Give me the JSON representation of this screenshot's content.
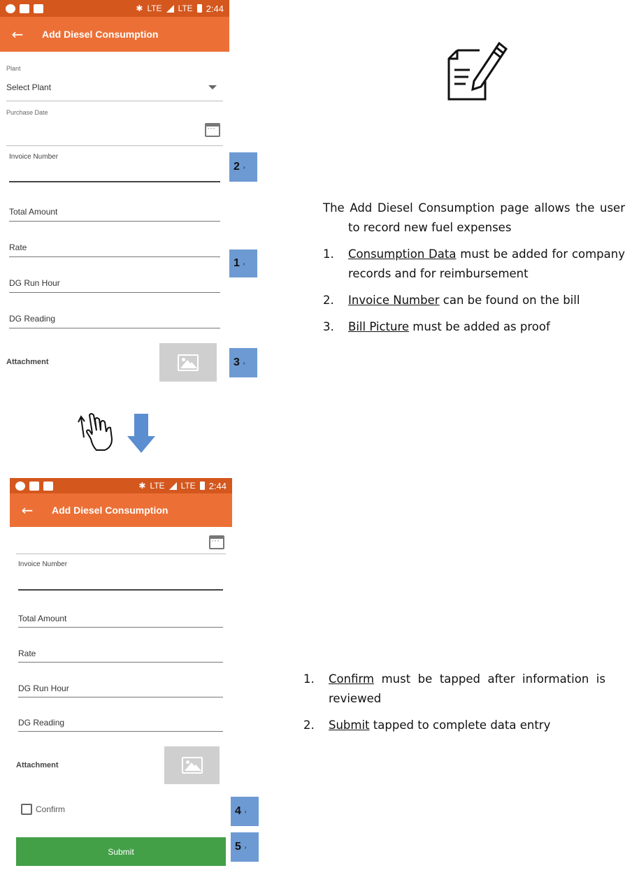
{
  "status_bar": {
    "time": "2:44",
    "network_1": "LTE",
    "network_2": "LTE"
  },
  "app_bar": {
    "back_icon": "arrow-left-icon",
    "title": "Add Diesel Consumption"
  },
  "form": {
    "plant_label": "Plant",
    "plant_value": "Select Plant",
    "purchase_date_label": "Purchase Date",
    "invoice_number_label": "Invoice Number",
    "total_amount_label": "Total Amount",
    "rate_label": "Rate",
    "dg_run_hour_label": "DG Run Hour",
    "dg_reading_label": "DG Reading",
    "attachment_label": "Attachment",
    "confirm_label": "Confirm",
    "submit_label": "Submit"
  },
  "badges": [
    "2",
    "1",
    "3",
    "4",
    "5"
  ],
  "description_1": {
    "intro": "The Add Diesel Consumption page allows the user to record new fuel expenses",
    "items": [
      {
        "num": "1.",
        "link": "Consumption Data",
        "text": " must be added for company records and for reimbursement"
      },
      {
        "num": "2.",
        "link": "Invoice Number",
        "text": " can be found on the bill"
      },
      {
        "num": "3.",
        "link": "Bill Picture",
        "text": " must be added as proof"
      }
    ]
  },
  "description_2": {
    "items": [
      {
        "num": "1.",
        "link": "Confirm",
        "text": " must be tapped after information is reviewed"
      },
      {
        "num": "2.",
        "link": "Submit",
        "text": " tapped to complete data entry"
      }
    ]
  },
  "colors": {
    "app_bar": "#ec7036",
    "status_bar": "#d4571e",
    "badge": "#6d9ad3",
    "submit": "#43a047"
  }
}
